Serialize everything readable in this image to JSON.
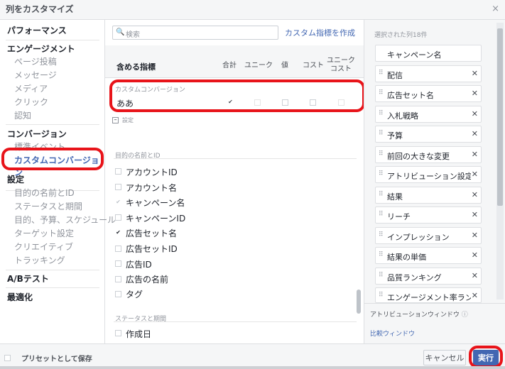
{
  "dialog": {
    "title": "列をカスタマイズ",
    "close": "×"
  },
  "nav": {
    "performance": "パフォーマンス",
    "engagement": "エンゲージメント",
    "engagement_items": [
      "ページ投稿",
      "メッセージ",
      "メディア",
      "クリック",
      "認知"
    ],
    "conversion": "コンバージョン",
    "conversion_items": [
      "標準イベント"
    ],
    "custom_conversion": "カスタムコンバージョン",
    "settings": "設定",
    "settings_items": [
      "目的の名前とID",
      "ステータスと期間",
      "目的、予算、スケジュール",
      "ターゲット設定",
      "クリエイティブ",
      "トラッキング"
    ],
    "ab_test": "A/Bテスト",
    "optimization": "最適化"
  },
  "search": {
    "placeholder": "検索",
    "create_link": "カスタム指標を作成"
  },
  "table": {
    "title": "含める指標",
    "headers": [
      "合計",
      "ユニーク",
      "値",
      "コスト",
      "ユニーク\nコスト"
    ],
    "custom_conv_category": "カスタムコンバージョン",
    "custom_conv_row": {
      "label": "ああ",
      "checks": [
        true,
        false,
        false,
        false,
        false
      ]
    },
    "settings_toggle": "設定",
    "category_name_id": "目的の名前とID",
    "rows": [
      {
        "label": "アカウントID",
        "checked": false,
        "disabled": false
      },
      {
        "label": "アカウント名",
        "checked": false,
        "disabled": false
      },
      {
        "label": "キャンペーン名",
        "checked": true,
        "disabled": true
      },
      {
        "label": "キャンペーンID",
        "checked": false,
        "disabled": false
      },
      {
        "label": "広告セット名",
        "checked": true,
        "disabled": false
      },
      {
        "label": "広告セットID",
        "checked": false,
        "disabled": false
      },
      {
        "label": "広告ID",
        "checked": false,
        "disabled": false
      },
      {
        "label": "広告の名前",
        "checked": false,
        "disabled": false
      },
      {
        "label": "タグ",
        "checked": false,
        "disabled": false
      }
    ],
    "category_status": "ステータスと期間",
    "status_rows": [
      {
        "label": "作成日",
        "checked": false
      }
    ]
  },
  "selected": {
    "title": "選択された列18件",
    "fixed": "キャンペーン名",
    "items": [
      "配信",
      "広告セット名",
      "入札戦略",
      "予算",
      "前回の大きな変更",
      "アトリビューション設定",
      "結果",
      "リーチ",
      "インプレッション",
      "結果の単価",
      "品質ランキング",
      "エンゲージメント率ランキング"
    ],
    "attribution_label": "アトリビューションウィンドウ",
    "compare_link": "比較ウィンドウ"
  },
  "footer": {
    "preset_label": "プリセットとして保存",
    "cancel": "キャンセル",
    "run": "実行"
  },
  "colors": {
    "accent": "#4267b2",
    "annotation": "#e8141a"
  }
}
